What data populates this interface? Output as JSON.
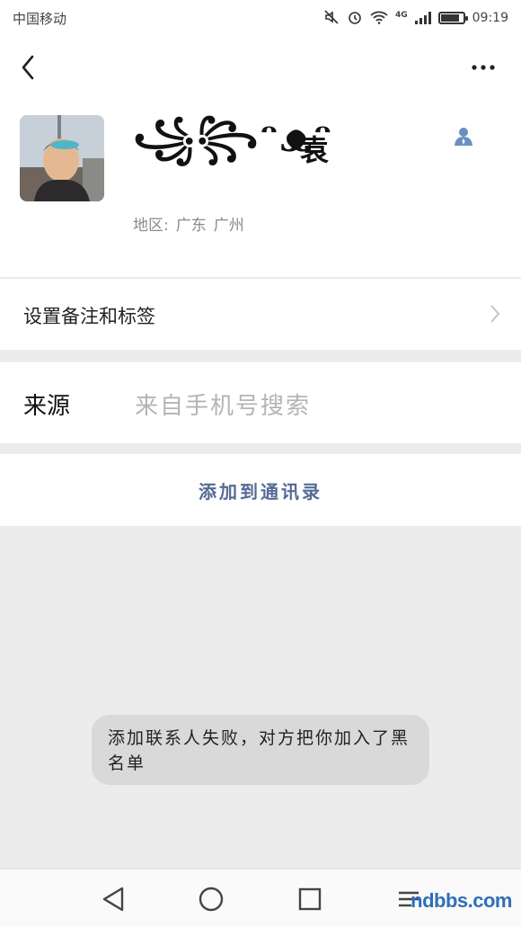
{
  "status_bar": {
    "carrier": "中国移动",
    "network": "4G",
    "time": "09:19",
    "icons": [
      "mute-icon",
      "alarm-icon",
      "wifi-icon",
      "signal-icon",
      "battery-icon"
    ]
  },
  "header": {
    "back_icon": "back-arrow-icon",
    "more_icon": "more-dots-icon"
  },
  "profile": {
    "nickname_decorative": "꧁꧂ᵔᴥᵔ",
    "surname": "袁",
    "region_label": "地区:",
    "region_province": "广东",
    "region_city": "广州",
    "contact_icon": "contact-person-icon"
  },
  "remark_row": {
    "label": "设置备注和标签"
  },
  "source_row": {
    "label": "来源",
    "value": "来自手机号搜索"
  },
  "add_button": {
    "label": "添加到通讯录"
  },
  "toast": {
    "message": "添加联系人失败，对方把你加入了黑名单"
  },
  "watermark": {
    "text": "ndbbs.com"
  },
  "colors": {
    "accent": "#566a94",
    "contact_icon": "#6a8fc0",
    "toast_bg": "#d9d9d9",
    "page_bg": "#ececec"
  }
}
